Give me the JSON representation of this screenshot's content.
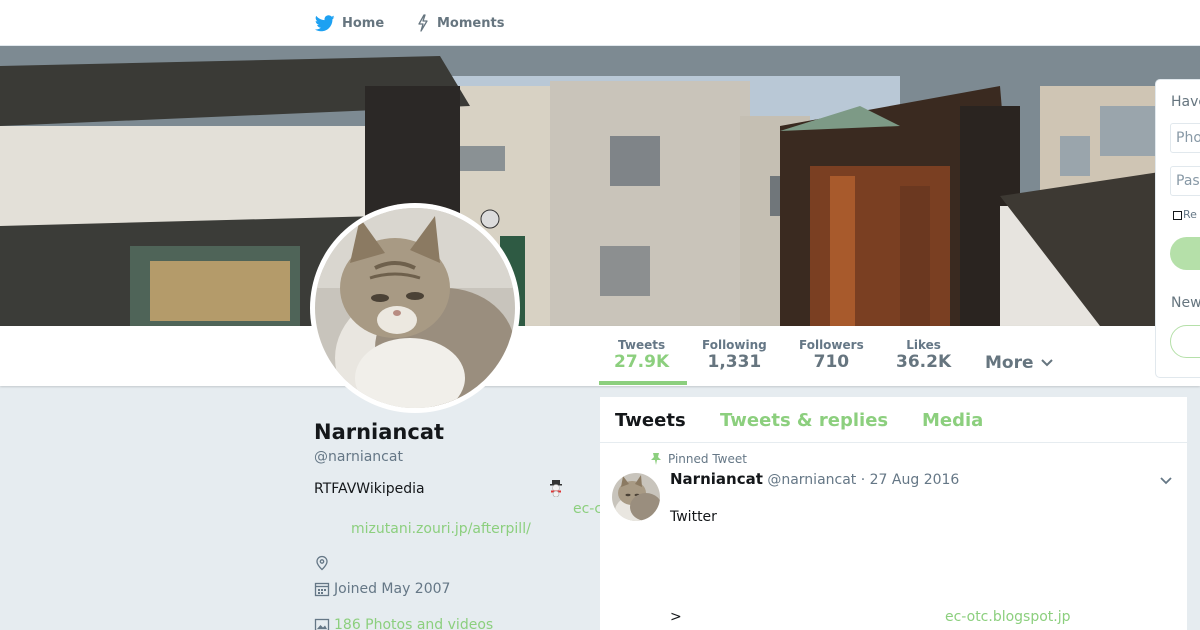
{
  "nav": {
    "home": "Home",
    "moments": "Moments",
    "home_icon": "twitter-bird-icon",
    "moments_icon": "lightning-icon"
  },
  "profile": {
    "name": "Narniancat",
    "handle": "@narniancat",
    "bio": "RTFAVWikipedia",
    "bio_emoji": "snowman-icon",
    "floating_link": "ec-c",
    "link": "mizutani.zouri.jp/afterpill/",
    "location": "",
    "joined": "Joined May 2007",
    "photos": "186 Photos and videos"
  },
  "stats": [
    {
      "label": "Tweets",
      "value": "27.9K",
      "active": true
    },
    {
      "label": "Following",
      "value": "1,331",
      "active": false
    },
    {
      "label": "Followers",
      "value": "710",
      "active": false
    },
    {
      "label": "Likes",
      "value": "36.2K",
      "active": false
    }
  ],
  "more": "More",
  "timeline": {
    "tabs": [
      "Tweets",
      "Tweets & replies",
      "Media"
    ],
    "pinned_label": "Pinned Tweet",
    "tweet": {
      "author": "Narniancat",
      "meta": "@narniancat · 27 Aug 2016",
      "text": "Twitter",
      "trailing": ">",
      "link": "ec-otc.blogspot.jp"
    }
  },
  "login": {
    "title": "Have",
    "phone_placeholder": "Pho",
    "password_placeholder": "Pass",
    "remember": "Re",
    "new_title": "New"
  },
  "colors": {
    "accent": "#8ccf7e",
    "text": "#14171a",
    "muted": "#657786",
    "background": "#e6ecf0"
  }
}
